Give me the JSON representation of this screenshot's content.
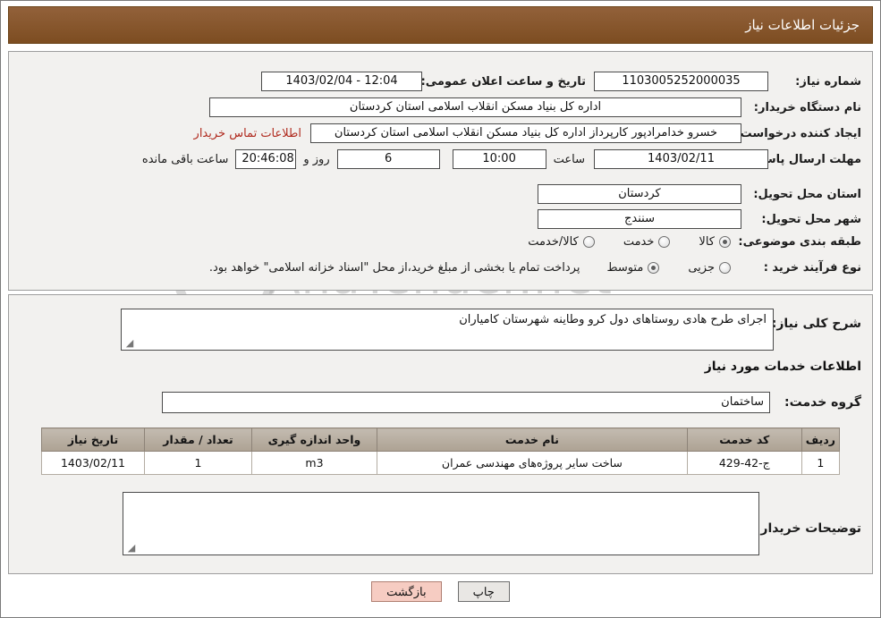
{
  "header": {
    "title": "جزئیات اطلاعات نیاز"
  },
  "form": {
    "need_number_label": "شماره نیاز:",
    "need_number_value": "1103005252000035",
    "announce_datetime_label": "تاریخ و ساعت اعلان عمومی:",
    "announce_datetime_value": "1403/02/04 - 12:04",
    "buyer_org_label": "نام دستگاه خریدار:",
    "buyer_org_value": "اداره کل بنیاد مسکن انقلاب اسلامی استان کردستان",
    "requester_label": "ایجاد کننده درخواست:",
    "requester_value": "خسرو خدامرادپور کارپرداز اداره کل بنیاد مسکن انقلاب اسلامی استان کردستان",
    "contact_link": "اطلاعات تماس خریدار",
    "deadline_label": "مهلت ارسال پاسخ: تا تاریخ:",
    "deadline_date": "1403/02/11",
    "deadline_time_label": "ساعت",
    "deadline_time_value": "10:00",
    "remaining_days_value": "6",
    "remaining_days_label": "روز و",
    "remaining_clock_value": "20:46:08",
    "remaining_suffix": "ساعت باقی مانده",
    "province_label": "استان محل تحویل:",
    "province_value": "کردستان",
    "city_label": "شهر محل تحویل:",
    "city_value": "سنندج",
    "category_label": "طبقه بندی موضوعی:",
    "category_options": [
      {
        "label": "کالا",
        "checked": true
      },
      {
        "label": "خدمت",
        "checked": false
      },
      {
        "label": "کالا/خدمت",
        "checked": false
      }
    ],
    "process_label": "نوع فرآیند خرید :",
    "process_options": [
      {
        "label": "جزیی",
        "checked": false
      },
      {
        "label": "متوسط",
        "checked": true
      }
    ],
    "process_note": "پرداخت تمام یا بخشی از مبلغ خرید،از محل \"اسناد خزانه اسلامی\" خواهد بود."
  },
  "details": {
    "general_desc_label": "شرح کلی نیاز:",
    "general_desc_value": "اجرای طرح هادی روستاهای دول کرو وطاینه شهرستان کامیاران",
    "services_info_title": "اطلاعات خدمات مورد نیاز",
    "service_group_label": "گروه خدمت:",
    "service_group_value": "ساختمان",
    "buyer_notes_label": "توضیحات خریدار:",
    "buyer_notes_value": ""
  },
  "table": {
    "headers": [
      "ردیف",
      "کد خدمت",
      "نام خدمت",
      "واحد اندازه گیری",
      "تعداد / مقدار",
      "تاریخ نیاز"
    ],
    "rows": [
      {
        "index": "1",
        "code": "ج-42-429",
        "name": "ساخت سایر پروژه‌های مهندسی عمران",
        "unit": "m3",
        "qty": "1",
        "date": "1403/02/11"
      }
    ]
  },
  "footer": {
    "print_label": "چاپ",
    "back_label": "بازگشت"
  },
  "watermark": {
    "text": "AnaTender.net"
  }
}
